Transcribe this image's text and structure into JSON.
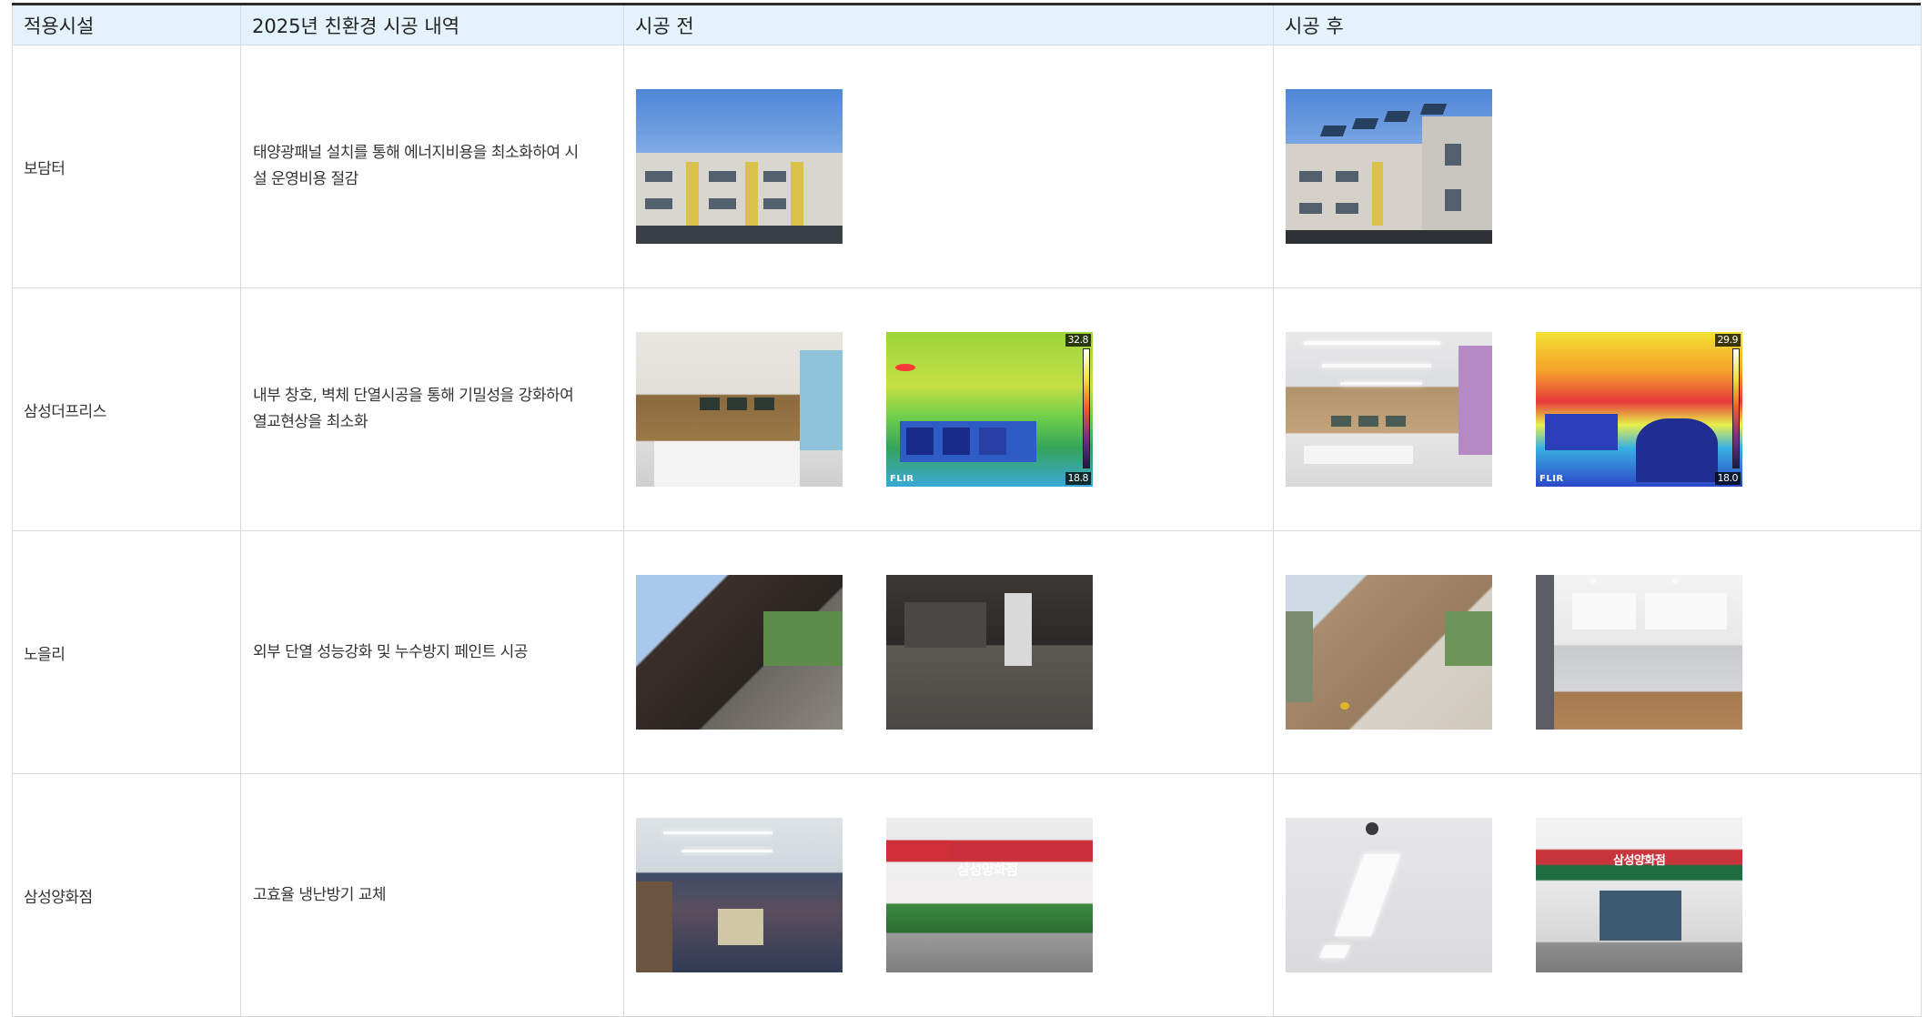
{
  "table": {
    "headers": {
      "facility": "적용시설",
      "description": "2025년 친환경 시공 내역",
      "before": "시공 전",
      "after": "시공 후"
    },
    "rows": [
      {
        "facility": "보담터",
        "description": "태양광패널 설치를 통해 에너지비용을 최소화하여 시설 운영비용 절감",
        "before_photos": [
          "building-exterior-before"
        ],
        "after_photos": [
          "building-exterior-solar-after"
        ]
      },
      {
        "facility": "삼성더프리스",
        "description": "내부 창호, 벽체 단열시공을 통해 기밀성을 강화하여 열교현상을 최소화",
        "before_photos": [
          "interior-room-before",
          "thermal-image-before"
        ],
        "after_photos": [
          "interior-room-after",
          "thermal-image-after"
        ],
        "thermal_before": {
          "max": "32.8",
          "min": "18.8",
          "brand": "FLIR"
        },
        "thermal_after": {
          "max": "29.9",
          "min": "18.0",
          "brand": "FLIR"
        }
      },
      {
        "facility": "노을리",
        "description": "외부 단열 성능강화 및 누수방지 페인트 시공",
        "before_photos": [
          "burnt-exterior-before",
          "burnt-interior-before"
        ],
        "after_photos": [
          "repaired-exterior-after",
          "kitchen-interior-after"
        ]
      },
      {
        "facility": "삼성양화점",
        "description": "고효율 냉난방기 교체",
        "before_photos": [
          "shoe-store-interior-before",
          "storefront-street-before"
        ],
        "after_photos": [
          "ceiling-light-after",
          "storefront-street-after"
        ],
        "sign_before": "삼성양화점",
        "sign_after": "삼성양화점"
      }
    ]
  },
  "colors": {
    "header_bg": "#e4f3fb",
    "border": "#d9d9d9",
    "top_border": "#2b2b2b"
  }
}
